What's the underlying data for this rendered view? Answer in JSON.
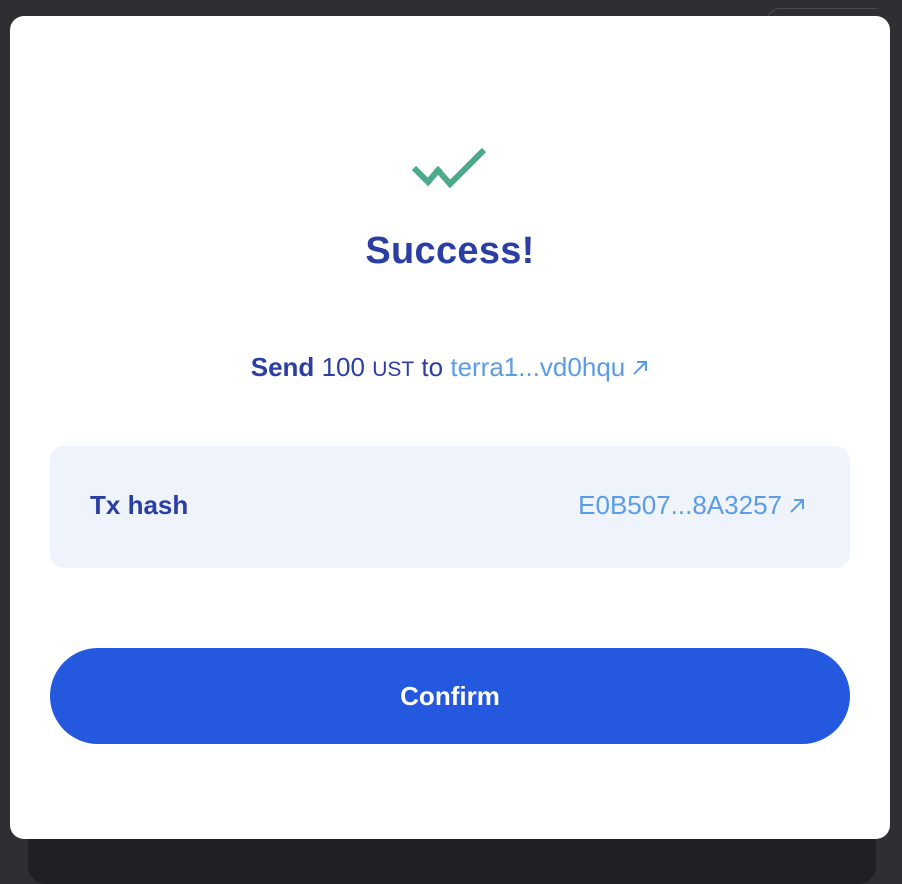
{
  "modal": {
    "title": "Success!",
    "icon": "double-check-icon",
    "summary": {
      "action": "Send",
      "amount": "100",
      "denom": "UST",
      "preposition": "to",
      "recipient": "terra1...vd0hqu"
    },
    "tx_hash": {
      "label": "Tx hash",
      "value": "E0B507...8A3257"
    },
    "confirm_label": "Confirm"
  },
  "colors": {
    "title": "#2a3ea3",
    "link": "#5b9ce8",
    "check": "#4caa8a",
    "button": "#2458df",
    "hash_box": "#eff3fb"
  }
}
